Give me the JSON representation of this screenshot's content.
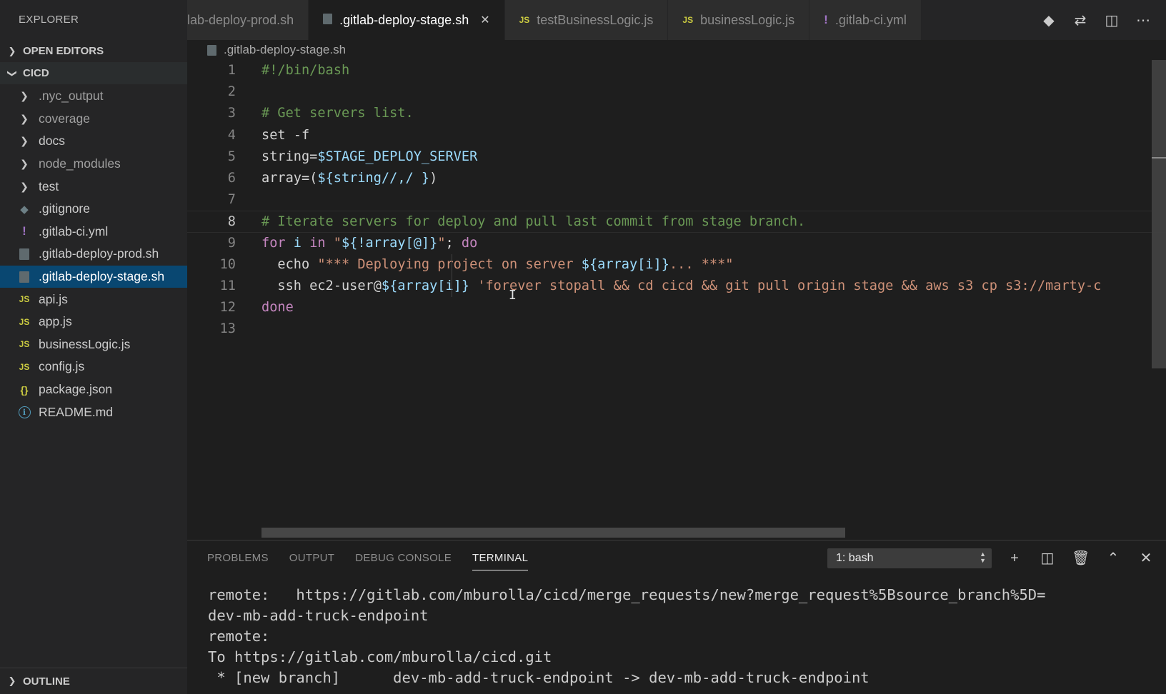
{
  "sidebar": {
    "title": "EXPLORER",
    "open_editors": "OPEN EDITORS",
    "project": "CICD",
    "outline": "OUTLINE",
    "items": [
      {
        "label": ".nyc_output",
        "type": "folder"
      },
      {
        "label": "coverage",
        "type": "folder"
      },
      {
        "label": "docs",
        "type": "folder"
      },
      {
        "label": "node_modules",
        "type": "folder"
      },
      {
        "label": "test",
        "type": "folder"
      },
      {
        "label": ".gitignore",
        "type": "git"
      },
      {
        "label": ".gitlab-ci.yml",
        "type": "yml"
      },
      {
        "label": ".gitlab-deploy-prod.sh",
        "type": "sh"
      },
      {
        "label": ".gitlab-deploy-stage.sh",
        "type": "sh",
        "selected": true
      },
      {
        "label": "api.js",
        "type": "js"
      },
      {
        "label": "app.js",
        "type": "js"
      },
      {
        "label": "businessLogic.js",
        "type": "js"
      },
      {
        "label": "config.js",
        "type": "js"
      },
      {
        "label": "package.json",
        "type": "json"
      },
      {
        "label": "README.md",
        "type": "md"
      }
    ]
  },
  "tabs": [
    {
      "label": "lab-deploy-prod.sh",
      "type": "none"
    },
    {
      "label": ".gitlab-deploy-stage.sh",
      "type": "sh",
      "active": true
    },
    {
      "label": "testBusinessLogic.js",
      "type": "js"
    },
    {
      "label": "businessLogic.js",
      "type": "js"
    },
    {
      "label": ".gitlab-ci.yml",
      "type": "yml"
    }
  ],
  "icons": {
    "js": "JS",
    "yml": "!",
    "json": "{}",
    "md": "i"
  },
  "breadcrumb": ".gitlab-deploy-stage.sh",
  "editor": {
    "current_line": 8,
    "lines": [
      {
        "n": "1",
        "tokens": [
          {
            "t": "#!/bin/bash",
            "c": "com"
          }
        ]
      },
      {
        "n": "2",
        "tokens": []
      },
      {
        "n": "3",
        "tokens": [
          {
            "t": "# Get servers list.",
            "c": "com"
          }
        ]
      },
      {
        "n": "4",
        "tokens": [
          {
            "t": "set -f",
            "c": "plain"
          }
        ]
      },
      {
        "n": "5",
        "tokens": [
          {
            "t": "string=",
            "c": "plain"
          },
          {
            "t": "$STAGE_DEPLOY_SERVER",
            "c": "var"
          }
        ]
      },
      {
        "n": "6",
        "tokens": [
          {
            "t": "array=(",
            "c": "plain"
          },
          {
            "t": "${string//,/ }",
            "c": "var"
          },
          {
            "t": ")",
            "c": "plain"
          }
        ]
      },
      {
        "n": "7",
        "tokens": []
      },
      {
        "n": "8",
        "tokens": [
          {
            "t": "# Iterate servers for deploy and pull last commit from stage branch.",
            "c": "com"
          }
        ]
      },
      {
        "n": "9",
        "tokens": [
          {
            "t": "for",
            "c": "kw"
          },
          {
            "t": " i ",
            "c": "var"
          },
          {
            "t": "in",
            "c": "kw"
          },
          {
            "t": " \"",
            "c": "str"
          },
          {
            "t": "${!array[@]}",
            "c": "var"
          },
          {
            "t": "\"",
            "c": "str"
          },
          {
            "t": "; ",
            "c": "plain"
          },
          {
            "t": "do",
            "c": "kw"
          }
        ]
      },
      {
        "n": "10",
        "tokens": [
          {
            "t": "  echo ",
            "c": "plain"
          },
          {
            "t": "\"*** Deploying project on server ",
            "c": "str"
          },
          {
            "t": "${array[i]}",
            "c": "var"
          },
          {
            "t": "... ***\"",
            "c": "str"
          }
        ]
      },
      {
        "n": "11",
        "tokens": [
          {
            "t": "  ssh ec2-user@",
            "c": "plain"
          },
          {
            "t": "${array[i]}",
            "c": "var"
          },
          {
            "t": " 'forever stopall && cd cicd && git pull origin stage && aws s3 cp s3://marty-c",
            "c": "str"
          }
        ]
      },
      {
        "n": "12",
        "tokens": [
          {
            "t": "done",
            "c": "kw"
          }
        ]
      },
      {
        "n": "13",
        "tokens": []
      }
    ]
  },
  "panel": {
    "tabs": [
      "PROBLEMS",
      "OUTPUT",
      "DEBUG CONSOLE",
      "TERMINAL"
    ],
    "active_tab": "TERMINAL",
    "terminal_select": "1: bash",
    "terminal_lines": [
      "remote:   https://gitlab.com/mburolla/cicd/merge_requests/new?merge_request%5Bsource_branch%5D=",
      "dev-mb-add-truck-endpoint",
      "remote:",
      "To https://gitlab.com/mburolla/cicd.git",
      " * [new branch]      dev-mb-add-truck-endpoint -> dev-mb-add-truck-endpoint"
    ]
  },
  "colors": {
    "selection": "#094771",
    "comment": "#6a9955",
    "keyword": "#c586c0",
    "variable": "#9cdcfe",
    "string": "#ce9178",
    "js_icon": "#cbcb41",
    "yml_icon": "#a074c4"
  }
}
